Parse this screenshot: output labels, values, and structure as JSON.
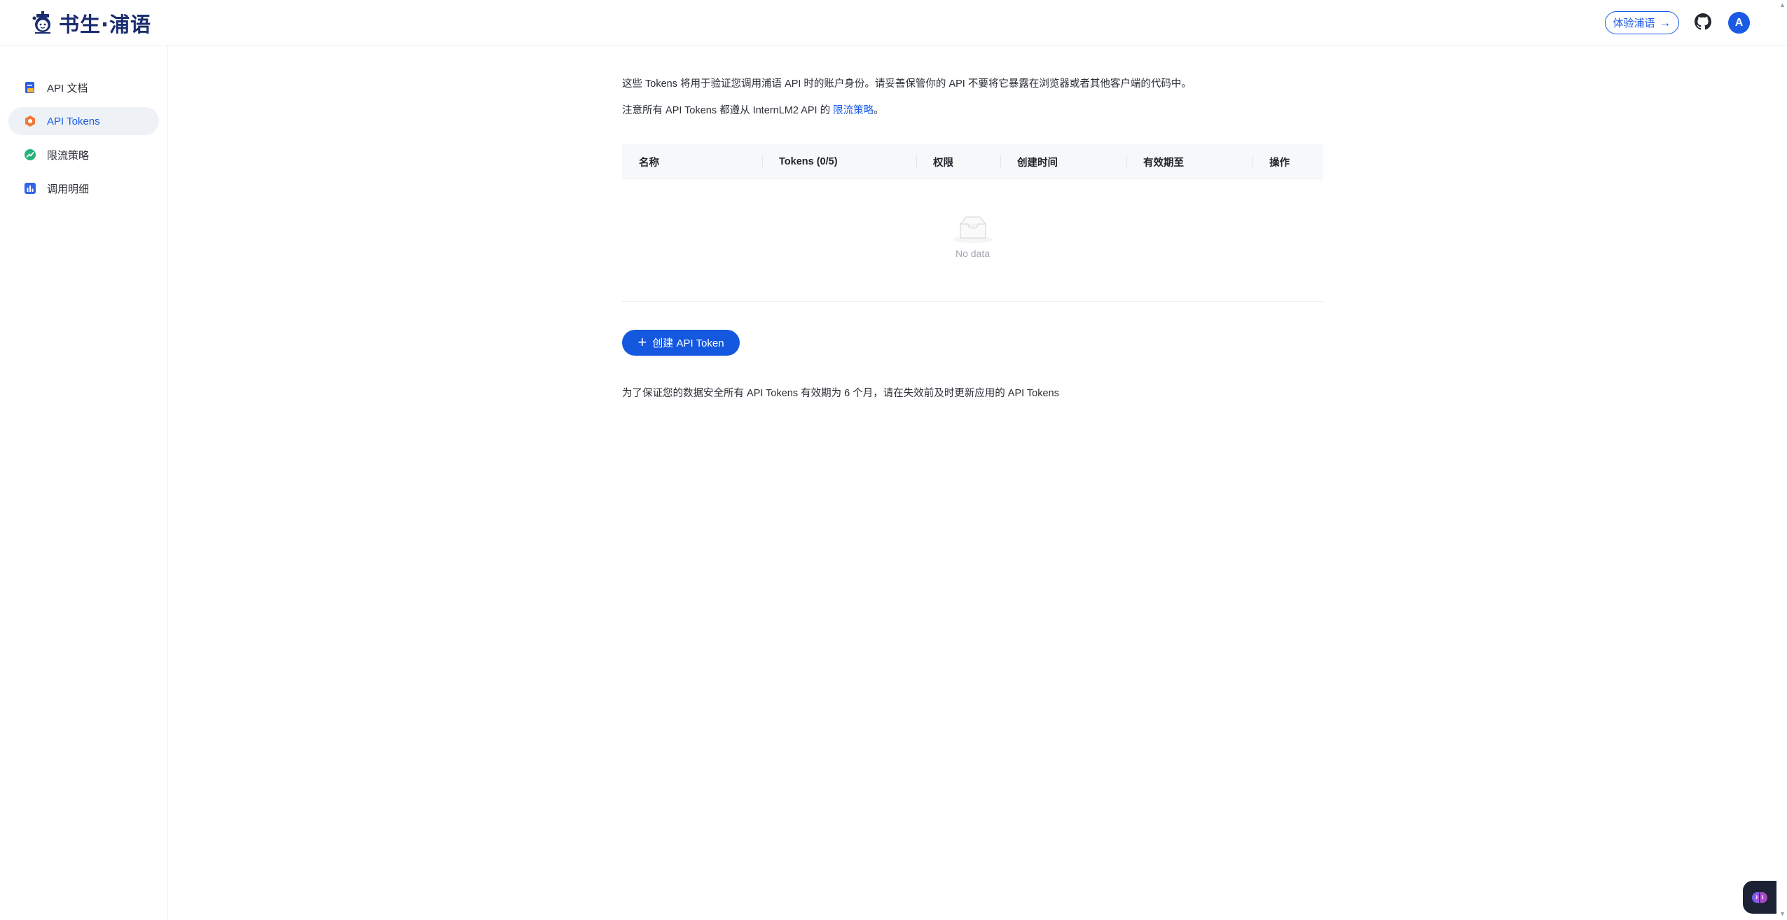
{
  "header": {
    "logo_text": "书生·浦语",
    "try_button_label": "体验浦语",
    "try_button_arrow": "→",
    "avatar_letter": "A"
  },
  "sidebar": {
    "items": [
      {
        "label": "API 文档",
        "icon": "doc-icon",
        "active": false
      },
      {
        "label": "API Tokens",
        "icon": "token-icon",
        "active": true
      },
      {
        "label": "限流策略",
        "icon": "rate-limit-icon",
        "active": false
      },
      {
        "label": "调用明细",
        "icon": "bar-chart-icon",
        "active": false
      }
    ]
  },
  "main": {
    "description_1": "这些 Tokens 将用于验证您调用浦语 API 时的账户身份。请妥善保管你的 API 不要将它暴露在浏览器或者其他客户端的代码中。",
    "description_2_prefix": "注意所有 API Tokens 都遵从 InternLM2 API 的 ",
    "description_2_link": "限流策略",
    "description_2_suffix": "。",
    "table": {
      "columns": [
        "名称",
        "Tokens (0/5)",
        "权限",
        "创建时间",
        "有效期至",
        "操作"
      ],
      "rows": [],
      "empty_text": "No data"
    },
    "create_button_label": "创建 API Token",
    "create_button_plus": "+",
    "footnote": "为了保证您的数据安全所有 API Tokens 有效期为 6 个月，请在失效前及时更新应用的 API Tokens"
  },
  "colors": {
    "accent": "#1a5be6",
    "primary_button": "#1458e0",
    "logo_text": "#1a2d6e",
    "sidebar_active_bg": "#eef1f6",
    "table_header_bg": "#f7f8fa",
    "empty_text": "#a3a8b0"
  }
}
